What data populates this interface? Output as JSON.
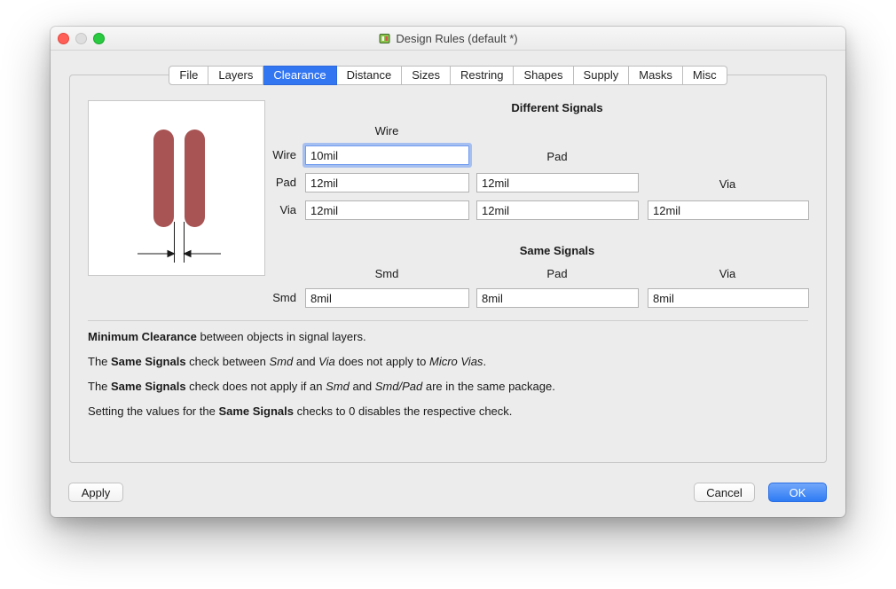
{
  "window": {
    "title": "Design Rules (default *)"
  },
  "tabs": [
    {
      "label": "File",
      "selected": false
    },
    {
      "label": "Layers",
      "selected": false
    },
    {
      "label": "Clearance",
      "selected": true
    },
    {
      "label": "Distance",
      "selected": false
    },
    {
      "label": "Sizes",
      "selected": false
    },
    {
      "label": "Restring",
      "selected": false
    },
    {
      "label": "Shapes",
      "selected": false
    },
    {
      "label": "Supply",
      "selected": false
    },
    {
      "label": "Masks",
      "selected": false
    },
    {
      "label": "Misc",
      "selected": false
    }
  ],
  "clearance": {
    "different_signals_title": "Different Signals",
    "same_signals_title": "Same Signals",
    "headers": {
      "wire": "Wire",
      "pad": "Pad",
      "via": "Via",
      "smd_same": "Smd",
      "pad_same": "Pad",
      "via_same": "Via"
    },
    "rows": {
      "wire": {
        "label": "Wire",
        "col1": "10mil"
      },
      "pad": {
        "label": "Pad",
        "col1": "12mil",
        "col2": "12mil"
      },
      "via": {
        "label": "Via",
        "col1": "12mil",
        "col2": "12mil",
        "col3": "12mil"
      },
      "smd": {
        "label": "Smd",
        "col1": "8mil",
        "col2": "8mil",
        "col3": "8mil"
      }
    },
    "notes": [
      [
        {
          "t": "Minimum Clearance",
          "b": 1
        },
        {
          "t": " between objects in signal layers."
        }
      ],
      [
        {
          "t": "The "
        },
        {
          "t": "Same Signals",
          "b": 1
        },
        {
          "t": " check between "
        },
        {
          "t": "Smd",
          "i": 1
        },
        {
          "t": " and "
        },
        {
          "t": "Via",
          "i": 1
        },
        {
          "t": " does not apply to "
        },
        {
          "t": "Micro Vias",
          "i": 1
        },
        {
          "t": "."
        }
      ],
      [
        {
          "t": "The "
        },
        {
          "t": "Same Signals",
          "b": 1
        },
        {
          "t": " check does not apply if an "
        },
        {
          "t": "Smd",
          "i": 1
        },
        {
          "t": " and "
        },
        {
          "t": "Smd/Pad",
          "i": 1
        },
        {
          "t": " are in the same package."
        }
      ],
      [
        {
          "t": "Setting the values for the "
        },
        {
          "t": "Same Signals",
          "b": 1
        },
        {
          "t": " checks to 0 disables the respective check."
        }
      ]
    ]
  },
  "buttons": {
    "apply": "Apply",
    "cancel": "Cancel",
    "ok": "OK"
  },
  "colors": {
    "accent_tab": "#3376f2",
    "ok_button": "#2d7bf4",
    "wire_fill": "#a85454",
    "focus_ring": "#6f9bf0"
  }
}
